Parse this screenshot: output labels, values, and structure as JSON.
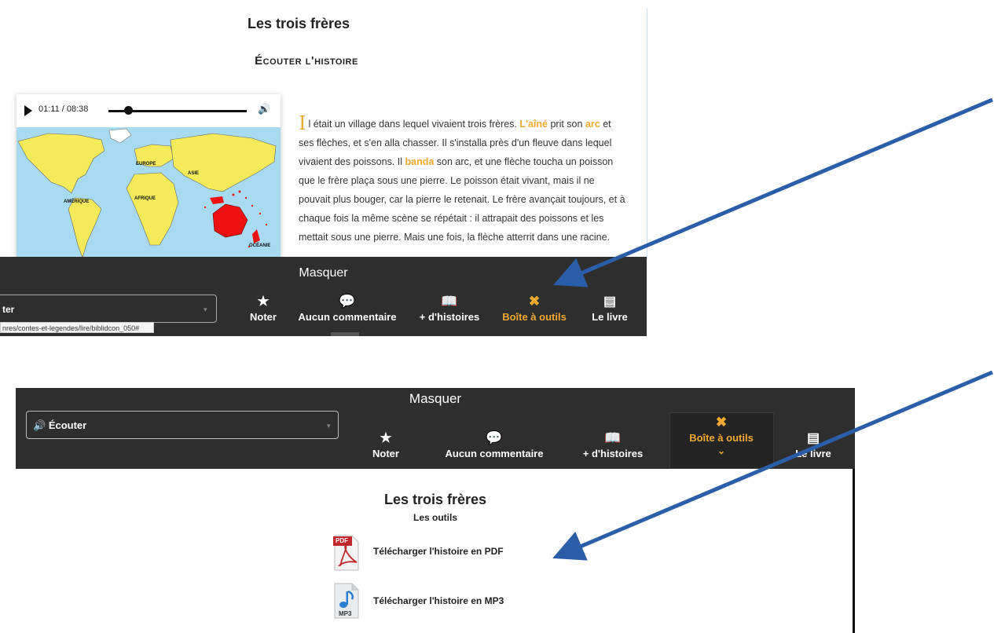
{
  "top": {
    "title": "Les trois frères",
    "section_heading": "Écouter l'histoire",
    "player": {
      "time": "01:11 / 08:38",
      "progress": 0.14
    },
    "map_labels": {
      "europe": "EUROPE",
      "asie": "ASIE",
      "amerique": "AMÉRIQUE",
      "afrique": "AFRIQUE",
      "oceanie": "OCÉANIE"
    },
    "story": {
      "dropcap": "I",
      "p1": "l était un village dans lequel vivaient trois frères. ",
      "hl1": "L'aîné",
      "p2": " prit son ",
      "hl2": "arc",
      "p3": " et ses flèches, et s'en alla chasser. Il s'installa près d'un fleuve dans lequel vivaient des poissons. Il ",
      "hl3": "banda",
      "p4": " son arc, et une flèche toucha un poisson que le frère plaça sous une pierre. Le poisson était vivant, mais il ne pouvait plus bouger, car la pierre le retenait. Le frère avançait toujours, et à chaque fois la même scène se répétait : il attrapait des poissons et les mettait sous une pierre. Mais une fois, la flèche atterrit dans une racine."
    },
    "toolbar": {
      "masquer": "Masquer",
      "select_text": "ter",
      "status_url": "nres/contes-et-legendes/lire/biblidcon_050#",
      "items": [
        "Noter",
        "Aucun commentaire",
        "+ d'histoires",
        "Boîte à outils",
        "Le livre"
      ]
    }
  },
  "bottom": {
    "toolbar": {
      "masquer": "Masquer",
      "select_text": "Écouter",
      "items": [
        "Noter",
        "Aucun commentaire",
        "+ d'histoires",
        "Boîte à outils",
        "Le livre"
      ]
    },
    "title": "Les trois frères",
    "subtitle": "Les outils",
    "tools": [
      {
        "label": "Télécharger l'histoire en PDF",
        "icon_text": "PDF"
      },
      {
        "label": "Télécharger l'histoire en MP3",
        "icon_text": "MP3"
      }
    ]
  },
  "colors": {
    "accent": "#f0a830",
    "toolbar_bg": "#2e2e2e",
    "arrow": "#2b5ea8"
  }
}
